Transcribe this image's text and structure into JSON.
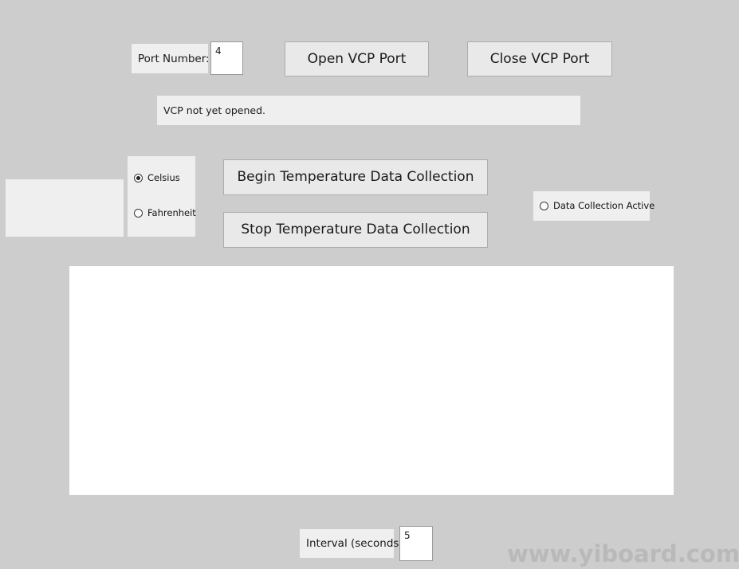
{
  "window": {
    "background_color": "#cdcdcd"
  },
  "port": {
    "label": "Port Number:",
    "value": "4",
    "placeholder": ""
  },
  "vcp": {
    "open_label": "Open VCP Port",
    "close_label": "Close VCP Port"
  },
  "status": {
    "message": "VCP not yet opened."
  },
  "display": {
    "value": ""
  },
  "units": {
    "options": [
      {
        "label": "Celsius",
        "selected": true
      },
      {
        "label": "Fahrenheit",
        "selected": false
      }
    ]
  },
  "collection": {
    "begin_label": "Begin Temperature Data Collection",
    "stop_label": "Stop Temperature Data Collection",
    "active_label": "Data Collection Active",
    "active_selected": false
  },
  "log": {
    "content": ""
  },
  "interval": {
    "label": "Interval (seconds):",
    "value": "5",
    "placeholder": ""
  },
  "watermark": {
    "text": "www.yiboard.com",
    "color": "#b9b9b9"
  }
}
